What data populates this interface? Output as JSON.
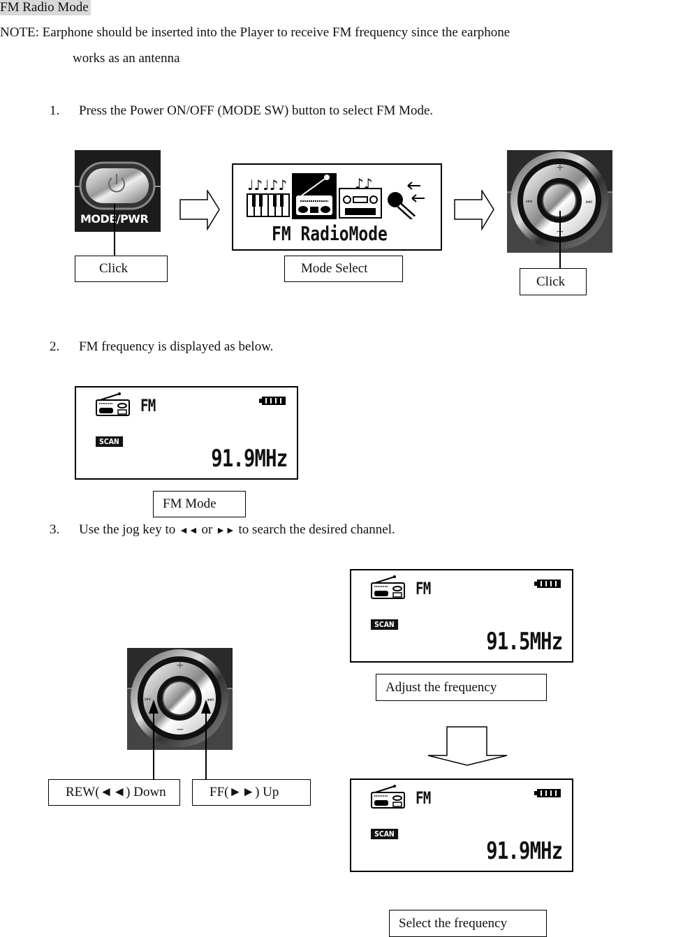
{
  "title": "FM Radio Mode",
  "note": {
    "line1": "NOTE: Earphone should be inserted into the Player to receive FM frequency since the earphone",
    "line2": "works as an antenna"
  },
  "steps": [
    {
      "number": "1.",
      "text": "Press the Power ON/OFF (MODE SW) button to select FM Mode."
    },
    {
      "number": "2.",
      "text": "FM frequency is displayed as below."
    },
    {
      "number": "3.",
      "text_before": "Use the jog key to",
      "rew_symbol": "◄◄",
      "or": "or",
      "ff_symbol": "►►",
      "text_after": "to search the desired channel."
    }
  ],
  "step1": {
    "power_button": {
      "label": "MODE/PWR",
      "icon": "power-icon"
    },
    "mode_menu": {
      "label": "FM RadioMode",
      "icons": [
        "music-keyboard-icon",
        "radio-icon",
        "cassette-icon",
        "microphone-icon"
      ],
      "selected": "radio-icon"
    },
    "callouts": {
      "click_left": "Click",
      "mode_select": "Mode Select",
      "click_right": "Click"
    }
  },
  "step2": {
    "lcd": {
      "band": "FM",
      "scan": "SCAN",
      "frequency": "91.9MHz"
    },
    "callout": "FM Mode"
  },
  "step3": {
    "jog_callouts": {
      "rew": "REW(◄◄) Down",
      "ff": "FF(►►) Up"
    },
    "lcd_before": {
      "band": "FM",
      "scan": "SCAN",
      "frequency": "91.5MHz"
    },
    "adjust_callout": "Adjust the frequency",
    "lcd_after": {
      "band": "FM",
      "scan": "SCAN",
      "frequency": "91.9MHz"
    },
    "select_callout": "Select the frequency"
  }
}
